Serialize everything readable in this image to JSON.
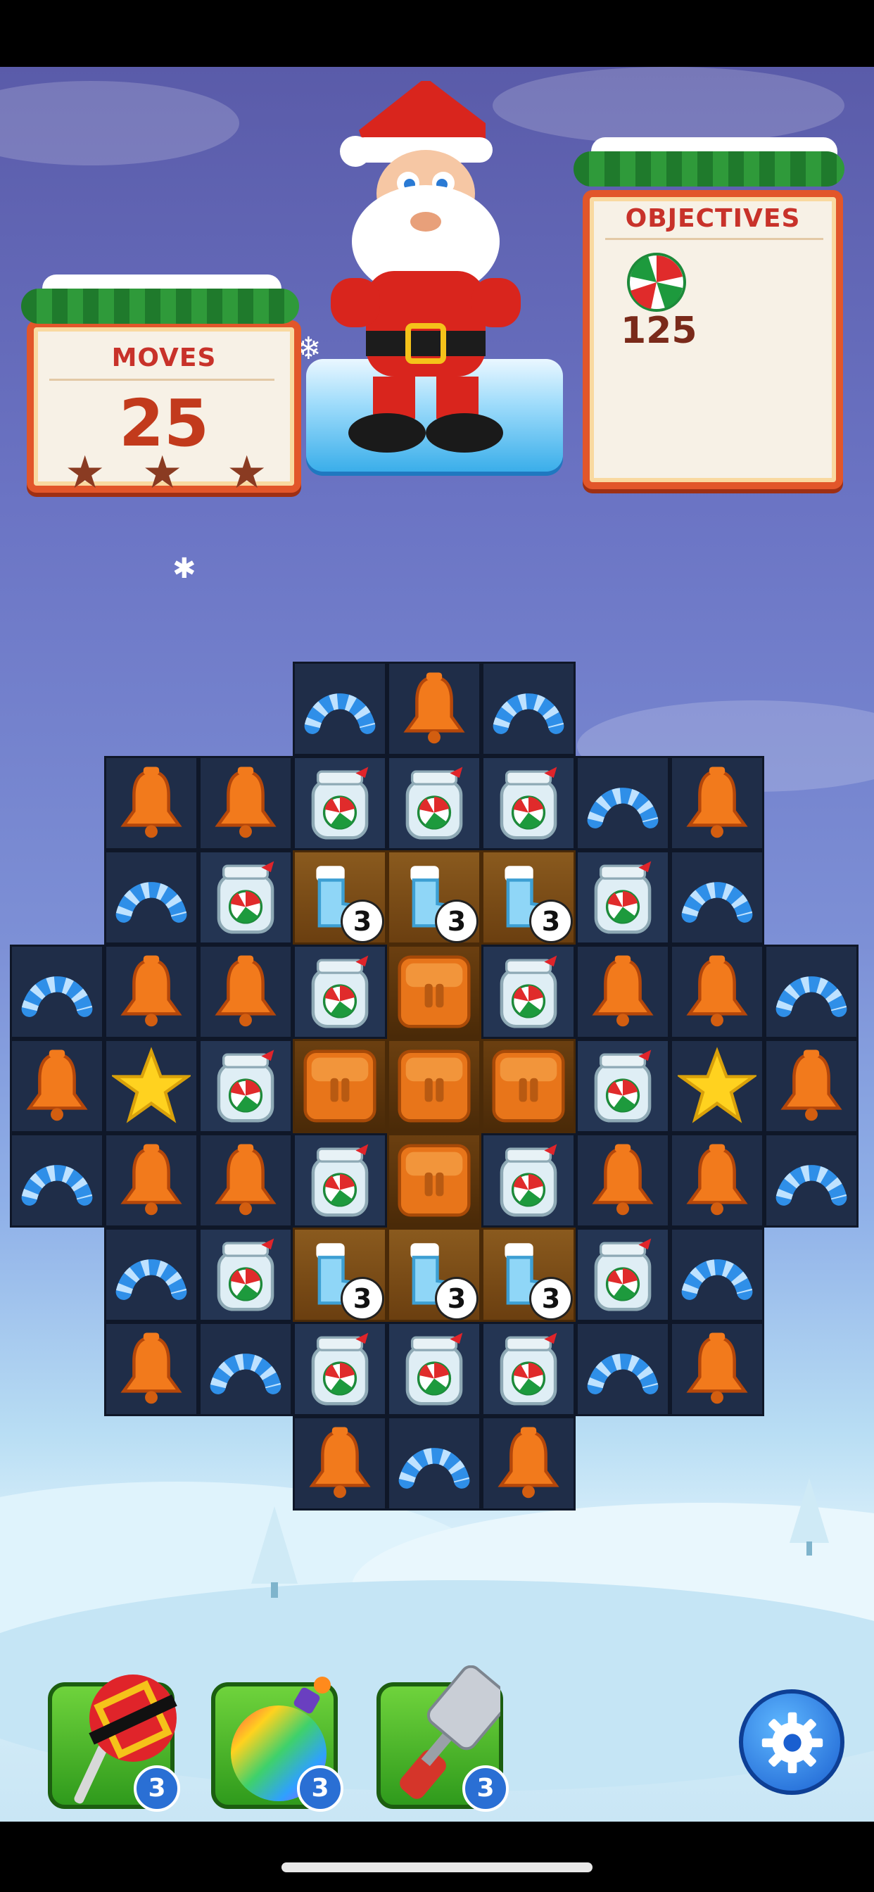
{
  "hud": {
    "moves_label": "MOVES",
    "moves_value": "25",
    "moves_stars": 3,
    "objectives_label": "OBJECTIVES",
    "objective_icon": "peppermint-candy-icon",
    "objective_count": "125"
  },
  "board": {
    "columns": 9,
    "rows": [
      [
        null,
        null,
        null,
        "candy-cane",
        "bell",
        "candy-cane",
        null,
        null,
        null
      ],
      [
        null,
        "bell",
        "bell",
        "jar",
        "jar",
        "jar",
        "candy-cane",
        "bell",
        null
      ],
      [
        null,
        "candy-cane",
        "jar",
        "boot",
        "boot",
        "boot",
        "jar",
        "candy-cane",
        null
      ],
      [
        "candy-cane",
        "bell",
        "bell",
        "jar",
        "honey",
        "jar",
        "bell",
        "bell",
        "candy-cane"
      ],
      [
        "bell",
        "star",
        "jar",
        "honey",
        "honey",
        "honey",
        "jar",
        "star",
        "bell"
      ],
      [
        "candy-cane",
        "bell",
        "bell",
        "jar",
        "honey",
        "jar",
        "bell",
        "bell",
        "candy-cane"
      ],
      [
        null,
        "candy-cane",
        "jar",
        "boot",
        "boot",
        "boot",
        "jar",
        "candy-cane",
        null
      ],
      [
        null,
        "bell",
        "candy-cane",
        "jar",
        "jar",
        "jar",
        "candy-cane",
        "bell",
        null
      ],
      [
        null,
        null,
        null,
        "bell",
        "candy-cane",
        "bell",
        null,
        null,
        null
      ]
    ],
    "boot_counter": "3"
  },
  "boosters": [
    {
      "name": "lollipop-hammer-icon",
      "count": "3"
    },
    {
      "name": "rainbow-bomb-icon",
      "count": "3"
    },
    {
      "name": "spatula-icon",
      "count": "3"
    }
  ],
  "settings": {
    "icon": "gear-icon"
  },
  "colors": {
    "bell": "#f27a1c",
    "candy_cane": "#2f8fe8",
    "star": "#ffd21f",
    "panel_border": "#e2562a",
    "title_red": "#c8322a"
  }
}
